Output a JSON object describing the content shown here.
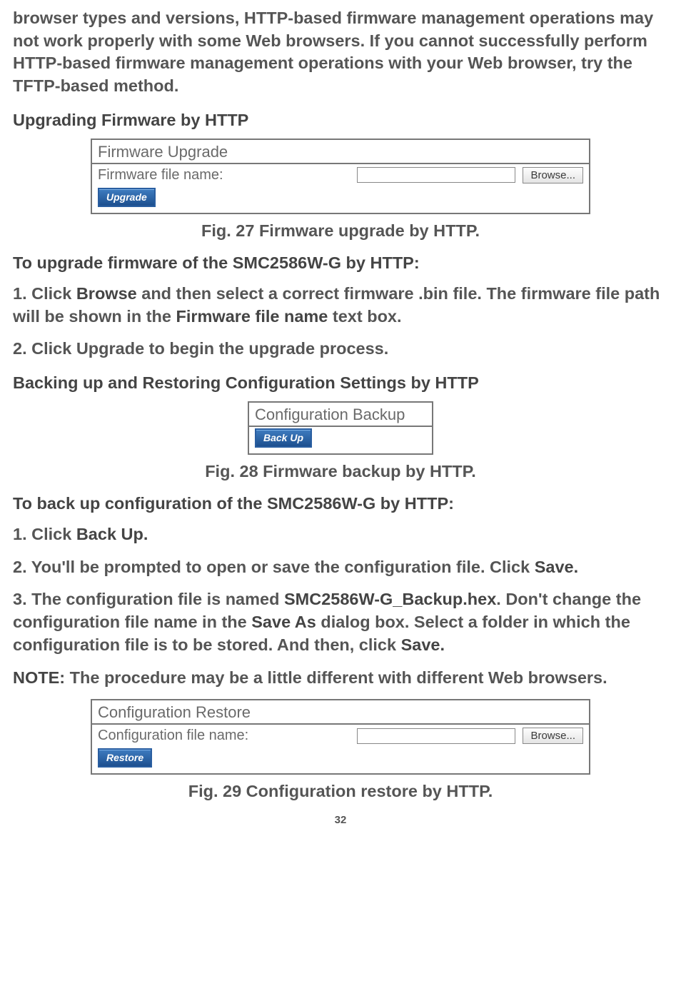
{
  "intro_paragraph": "browser types and versions, HTTP-based firmware management operations may not work properly with some Web browsers. If you cannot successfully perform HTTP-based firmware management operations with your Web browser, try the TFTP-based method.",
  "heading_upgrade": "Upgrading Firmware by HTTP",
  "fig27": {
    "title": "Firmware Upgrade",
    "label": "Firmware file name:",
    "browse": "Browse...",
    "upgrade": "Upgrade",
    "caption": "Fig. 27 Firmware upgrade by HTTP."
  },
  "heading_to_upgrade": "To upgrade firmware of the SMC2586W-G by HTTP:",
  "step1_prefix": "1. Click ",
  "step1_bold1": "Browse",
  "step1_mid": " and then select a correct firmware .bin file. The firmware file path will be shown in the ",
  "step1_bold2": "Firmware file name",
  "step1_suffix": " text box.",
  "step2": "2. Click Upgrade to begin the upgrade process.",
  "heading_backup_restore": "Backing up and Restoring Configuration Settings by HTTP",
  "fig28": {
    "title": "Configuration Backup",
    "backup": "Back Up",
    "caption": "Fig. 28 Firmware backup by HTTP."
  },
  "heading_to_backup": "To back up configuration of the SMC2586W-G by HTTP:",
  "b_step1_prefix": "1. Click ",
  "b_step1_bold": "Back Up.",
  "b_step2_prefix": "2. You'll be prompted to open or save the configuration file. Click ",
  "b_step2_bold": "Save.",
  "b_step3_prefix": "3. The configuration file is named ",
  "b_step3_bold1": "SMC2586W-G_Backup.hex",
  "b_step3_mid1": ". Don't change the configuration file name in the ",
  "b_step3_bold2": "Save As",
  "b_step3_mid2": " dialog box. Select a folder in which the configuration file is to be stored. And then, click ",
  "b_step3_bold3": "Save.",
  "note_bold": "NOTE:",
  "note_text": " The procedure may be a little different with different Web browsers.",
  "fig29": {
    "title": "Configuration Restore",
    "label": "Configuration file name:",
    "browse": "Browse...",
    "restore": "Restore",
    "caption": "Fig. 29 Configuration restore by HTTP."
  },
  "page_number": "32"
}
